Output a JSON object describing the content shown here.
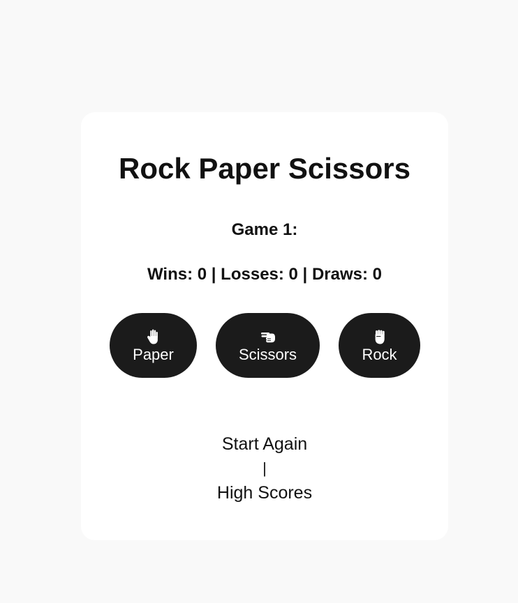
{
  "game": {
    "title": "Rock Paper Scissors",
    "round_label": "Game 1:",
    "score": {
      "wins_label": "Wins: 0",
      "losses_label": "Losses: 0",
      "draws_label": "Draws: 0",
      "separator": " | "
    }
  },
  "choices": [
    {
      "label": "Paper",
      "icon": "raised-hand-icon"
    },
    {
      "label": "Scissors",
      "icon": "victory-hand-icon"
    },
    {
      "label": "Rock",
      "icon": "raised-fist-icon"
    }
  ],
  "footer": {
    "start_again_label": "Start Again",
    "divider": "|",
    "high_scores_label": "High Scores"
  },
  "colors": {
    "page_background": "#f9f9f9",
    "card_background": "#ffffff",
    "button_background": "#1b1b1b",
    "button_text": "#ffffff",
    "text": "#111111"
  }
}
